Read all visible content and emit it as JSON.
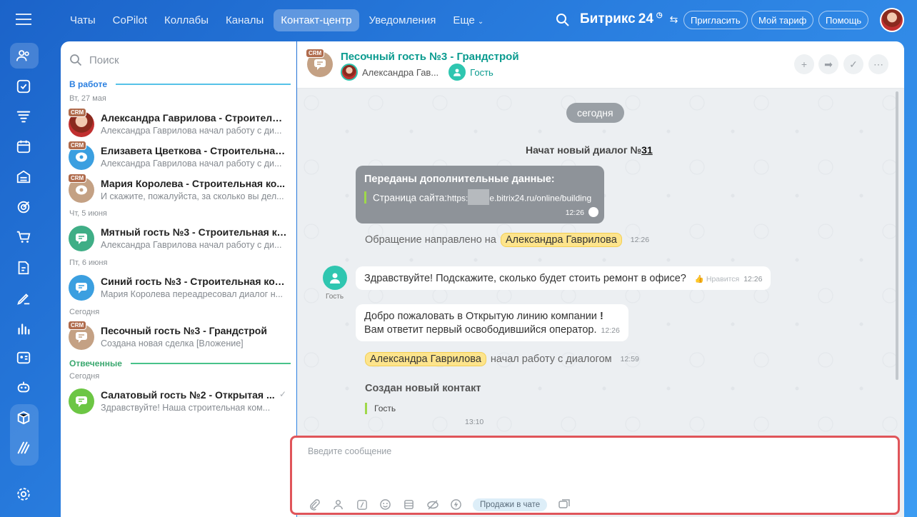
{
  "colors": {
    "accent": "#2a7fe0",
    "teal": "#0a9b8f",
    "highlight": "#fde48c",
    "composer_border": "#e0555a"
  },
  "topnav": {
    "tabs": [
      "Чаты",
      "CoPilot",
      "Коллабы",
      "Каналы",
      "Контакт-центр",
      "Уведомления",
      "Еще"
    ],
    "active_tab": "Контакт-центр",
    "brand": "Битрикс",
    "brand_num": "24",
    "invite": "Пригласить",
    "tariff": "Мой тариф",
    "help": "Помощь"
  },
  "sidebar_icons": [
    "menu-icon",
    "contacts-icon",
    "tasks-icon",
    "funnel-icon",
    "calendar-icon",
    "warehouse-icon",
    "target-icon",
    "cart-icon",
    "document-icon",
    "sign-icon",
    "analytics-icon",
    "idcard-icon",
    "robot-icon",
    "box-icon",
    "brush-icon",
    "settings-icon"
  ],
  "chatlist": {
    "search_placeholder": "Поиск",
    "section_in_work": "В работе",
    "section_answered": "Отвеченные",
    "crm_badge": "CRM",
    "dates": {
      "d1": "Вт, 27 мая",
      "d2": "Чт, 5 июня",
      "d3": "Пт, 6 июня",
      "d4": "Сегодня",
      "d5": "Сегодня"
    },
    "items": [
      {
        "title": "Александра Гаврилова - Строительн...",
        "sub": "Александра Гаврилова начал работу с ди..."
      },
      {
        "title": "Елизавета Цветкова - Строительная ...",
        "sub": "Александра Гаврилова начал работу с ди..."
      },
      {
        "title": "Мария Королева - Строительная ко...",
        "sub": "И скажите, пожалуйста, за сколько вы дел..."
      },
      {
        "title": "Мятный гость №3 - Строительная ко...",
        "sub": "Александра Гаврилова начал работу с ди..."
      },
      {
        "title": "Синий гость №3 - Строительная ком...",
        "sub": "Мария Королева переадресовал диалог н..."
      },
      {
        "title": "Песочный гость №3 - Грандстрой",
        "sub": "Создана новая сделка [Вложение]"
      },
      {
        "title": "Салатовый гость №2 - Открытая ...",
        "sub": "Здравствуйте! Наша строительная ком..."
      }
    ]
  },
  "chat": {
    "title": "Песочный гость №3 - Грандстрой",
    "member_operator": "Александра Гав...",
    "member_guest": "Гость",
    "date_pill": "сегодня",
    "new_dialog_prefix": "Начат новый диалог №",
    "new_dialog_num": "31",
    "extra_data_title": "Переданы дополнительные данные:",
    "site_label": "Страница сайта:",
    "site_url_a": "https:",
    "site_url_b": "e.bitrix24.ru/online/building",
    "extra_time": "12:26",
    "forwarded_text": "Обращение направлено на",
    "forwarded_name": "Александра Гаврилова",
    "forwarded_time": "12:26",
    "guest_label": "Гость",
    "guest_msg": "Здравствуйте! Подскажите, сколько будет стоить ремонт в офисе?",
    "guest_like": "Нравится",
    "guest_time": "12:26",
    "welcome_l1": "Добро пожаловать в Открытую линию компании",
    "welcome_excl": "!",
    "welcome_l2": "Вам ответит первый освободившийся оператор.",
    "welcome_time": "12:26",
    "started_name": "Александра Гаврилова",
    "started_text": "начал работу с диалогом",
    "started_time": "12:59",
    "created_title": "Создан новый контакт",
    "created_sub": "Гость",
    "created_time": "13:10"
  },
  "composer": {
    "placeholder": "Введите сообщение",
    "sales_button": "Продажи в чате"
  }
}
